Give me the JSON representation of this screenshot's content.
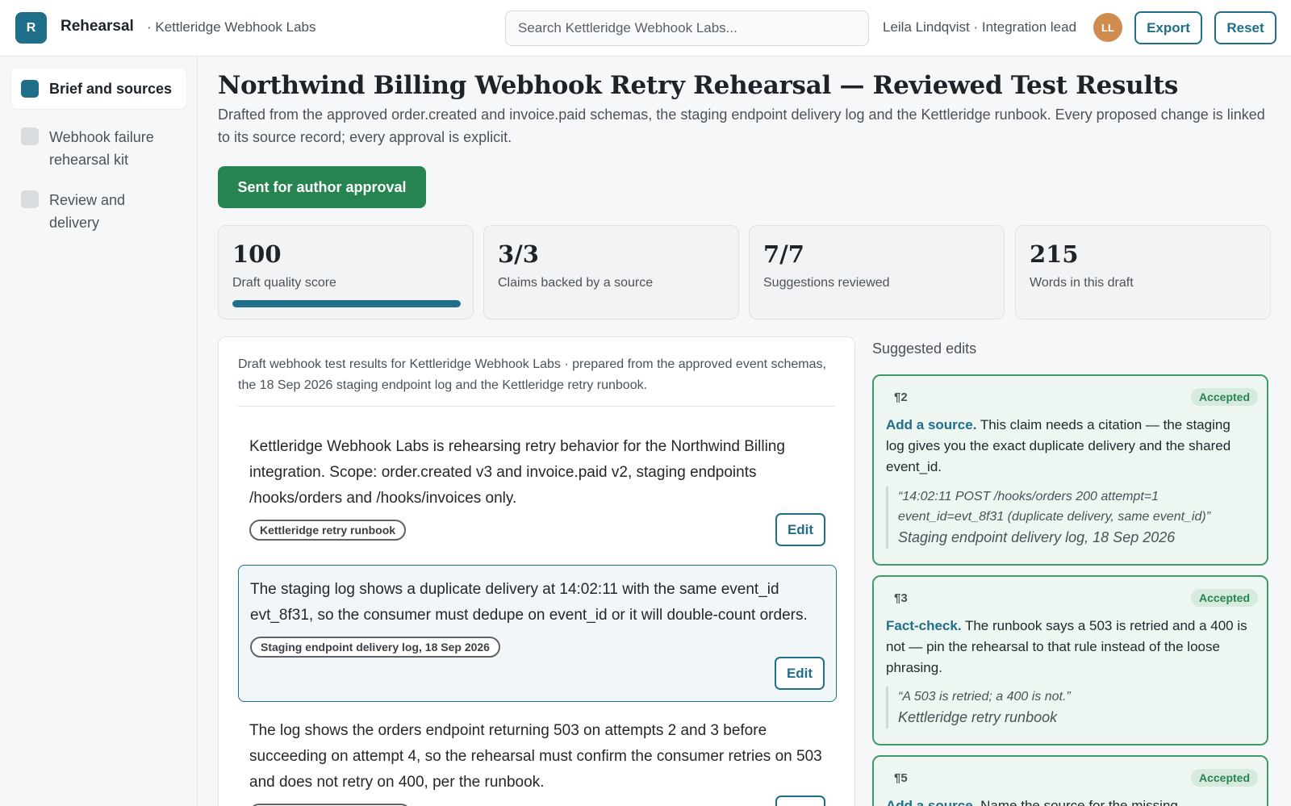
{
  "topbar": {
    "logo_letter": "R",
    "app_name": "Rehearsal",
    "workspace": "· Kettleridge Webhook Labs",
    "search_placeholder": "Search Kettleridge Webhook Labs...",
    "user": "Leila Lindqvist · Integration lead",
    "avatar_initials": "LL",
    "export_label": "Export",
    "reset_label": "Reset"
  },
  "sidebar": {
    "items": [
      {
        "label": "Brief and sources",
        "active": true
      },
      {
        "label": "Webhook failure rehearsal kit",
        "active": false
      },
      {
        "label": "Review and delivery",
        "active": false
      }
    ]
  },
  "main": {
    "title": "Northwind Billing Webhook Retry Rehearsal — Reviewed Test Results",
    "subtitle": "Drafted from the approved order.created and invoice.paid schemas, the staging endpoint delivery log and the Kettleridge runbook. Every proposed change is linked to its source record; every approval is explicit.",
    "status_button": "Sent for author approval",
    "stats": [
      {
        "value": "100",
        "label": "Draft quality score",
        "progress": 1.0
      },
      {
        "value": "3/3",
        "label": "Claims backed by a source"
      },
      {
        "value": "7/7",
        "label": "Suggestions reviewed"
      },
      {
        "value": "215",
        "label": "Words in this draft"
      }
    ]
  },
  "draft": {
    "header": "Draft webhook test results for Kettleridge Webhook Labs · prepared from the approved event schemas, the 18 Sep 2026 staging endpoint log and the Kettleridge retry runbook.",
    "edit_label": "Edit",
    "paragraphs": [
      {
        "text": "Kettleridge Webhook Labs is rehearsing retry behavior for the Northwind Billing integration. Scope: order.created v3 and invoice.paid v2, staging endpoints /hooks/orders and /hooks/invoices only.",
        "source": "Kettleridge retry runbook"
      },
      {
        "text": "The staging log shows a duplicate delivery at 14:02:11 with the same event_id evt_8f31, so the consumer must dedupe on event_id or it will double-count orders.",
        "source": "Staging endpoint delivery log, 18 Sep 2026"
      },
      {
        "text": "The log shows the orders endpoint returning 503 on attempts 2 and 3 before succeeding on attempt 4, so the rehearsal must confirm the consumer retries on 503 and does not retry on 400, per the runbook.",
        "source": ""
      }
    ]
  },
  "suggestions": {
    "title": "Suggested edits",
    "items": [
      {
        "para": "¶2",
        "status": "Accepted",
        "action": "Add a source.",
        "body": " This claim needs a citation — the staging log gives you the exact duplicate delivery and the shared event_id.",
        "quote": "“14:02:11 POST /hooks/orders 200 attempt=1 event_id=evt_8f31 (duplicate delivery, same event_id)”",
        "quote_source": "Staging endpoint delivery log, 18 Sep 2026"
      },
      {
        "para": "¶3",
        "status": "Accepted",
        "action": "Fact-check.",
        "body": " The runbook says a 503 is retried and a 400 is not — pin the rehearsal to that rule instead of the loose phrasing.",
        "quote": "“A 503 is retried; a 400 is not.”",
        "quote_source": "Kettleridge retry runbook"
      },
      {
        "para": "¶5",
        "status": "Accepted",
        "action": "Add a source.",
        "body": " Name the source for the missing"
      }
    ]
  },
  "colors": {
    "accent": "#1f6f8b",
    "success": "#27834f",
    "accepted_border": "#3f9b67"
  }
}
